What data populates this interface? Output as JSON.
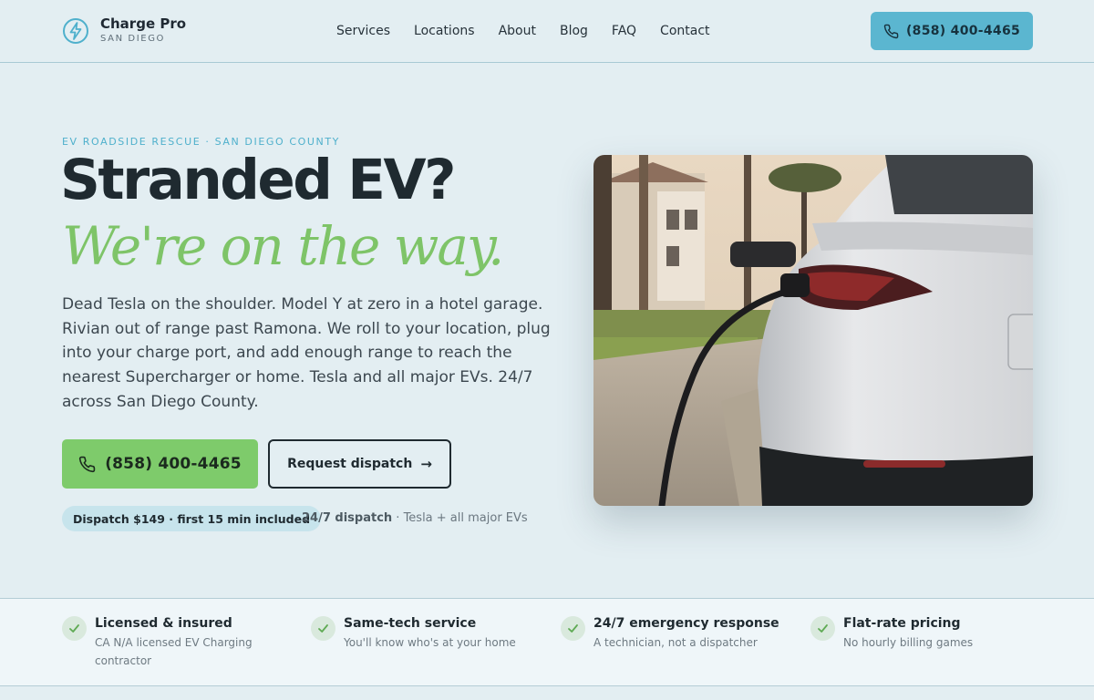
{
  "brand": {
    "name": "Charge Pro",
    "location": "SAN DIEGO"
  },
  "nav": {
    "items": [
      "Services",
      "Locations",
      "About",
      "Blog",
      "FAQ",
      "Contact"
    ]
  },
  "header": {
    "phone_label": "(858) 400-4465"
  },
  "hero": {
    "eyebrow": "EV ROADSIDE RESCUE · SAN DIEGO COUNTY",
    "headline": "Stranded EV?",
    "headline_accent": "We're on the way.",
    "lead": "Dead Tesla on the shoulder. Model Y at zero in a hotel garage. Rivian out of range past Ramona. We roll to your location, plug into your charge port, and add enough range to reach the nearest Supercharger or home. Tesla and all major EVs. 24/7 across San Diego County.",
    "primary_cta": "(858) 400-4465",
    "secondary_cta": "Request dispatch",
    "secondary_cta_icon": "arrow-right-icon",
    "price_pill": "Dispatch $149 · first 15 min included",
    "dispatch_strong": "24/7 dispatch",
    "dispatch_rest": " · Tesla + all major EVs"
  },
  "features": [
    {
      "title": "Licensed & insured",
      "desc": "CA N/A licensed EV Charging contractor"
    },
    {
      "title": "Same-tech service",
      "desc": "You'll know who's at your home"
    },
    {
      "title": "24/7 emergency response",
      "desc": "A technician, not a dispatcher"
    },
    {
      "title": "Flat-rate pricing",
      "desc": "No hourly billing games"
    }
  ],
  "colors": {
    "accent_blue": "#5bb6d0",
    "accent_green": "#7ecb6b",
    "background": "#e3eef2"
  }
}
